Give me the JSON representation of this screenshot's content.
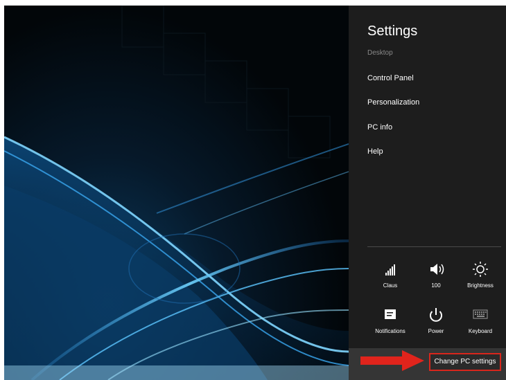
{
  "settings_pane": {
    "title": "Settings",
    "subtitle": "Desktop",
    "menu": [
      {
        "label": "Control Panel"
      },
      {
        "label": "Personalization"
      },
      {
        "label": "PC info"
      },
      {
        "label": "Help"
      }
    ],
    "quick_settings": [
      {
        "label": "Claus",
        "icon": "network-signal-icon"
      },
      {
        "label": "100",
        "icon": "volume-icon"
      },
      {
        "label": "Brightness",
        "icon": "brightness-icon"
      },
      {
        "label": "Notifications",
        "icon": "notifications-icon"
      },
      {
        "label": "Power",
        "icon": "power-icon"
      },
      {
        "label": "Keyboard",
        "icon": "keyboard-icon"
      }
    ],
    "change_pc_settings_label": "Change PC settings"
  },
  "colors": {
    "pane_background": "#1d1d1d",
    "bottom_bar": "#353535",
    "highlight_border": "#d9261c",
    "arrow": "#e0241c"
  }
}
